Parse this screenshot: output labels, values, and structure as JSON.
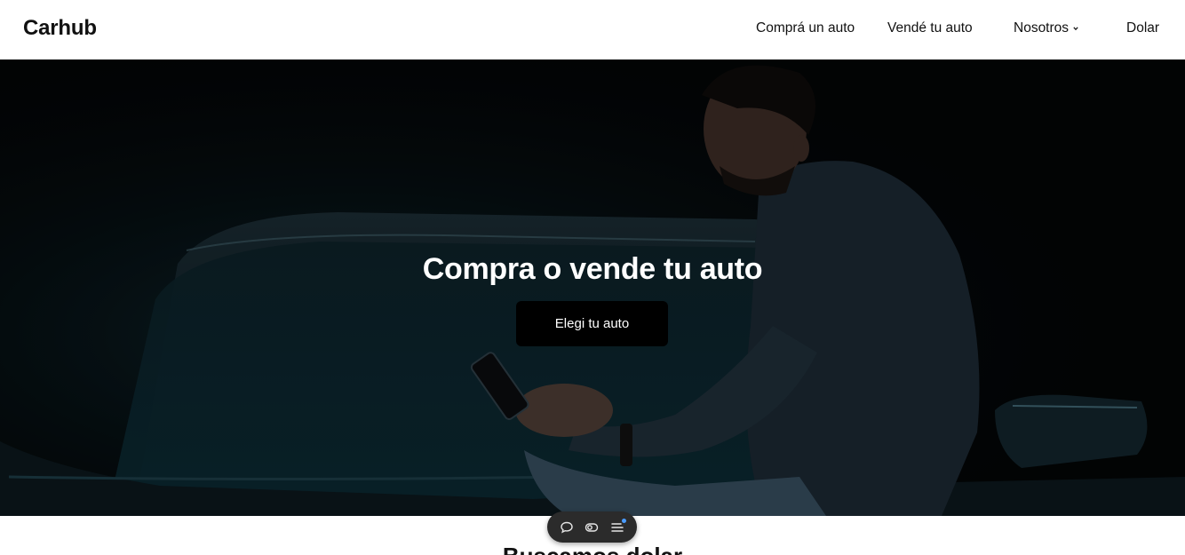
{
  "navbar": {
    "brand": "Carhub",
    "links": {
      "buy": "Comprá un auto",
      "sell": "Vendé tu auto",
      "about": "Nosotros",
      "dollar": "Dolar"
    }
  },
  "hero": {
    "title": "Compra o vende tu auto",
    "cta_label": "Elegi tu auto",
    "image_description_icon": "man-with-phone-on-car-photo"
  },
  "below": {
    "section_title": "Buscamos dolar"
  },
  "toolbar": {
    "icons": [
      "chat-bubble-icon",
      "toggle-icon",
      "menu-list-icon"
    ]
  },
  "colors": {
    "hero_bg": "#030506",
    "button_bg": "#000000",
    "toolbar_bg": "#2b2b2b",
    "notification_dot": "#4a9cff"
  }
}
